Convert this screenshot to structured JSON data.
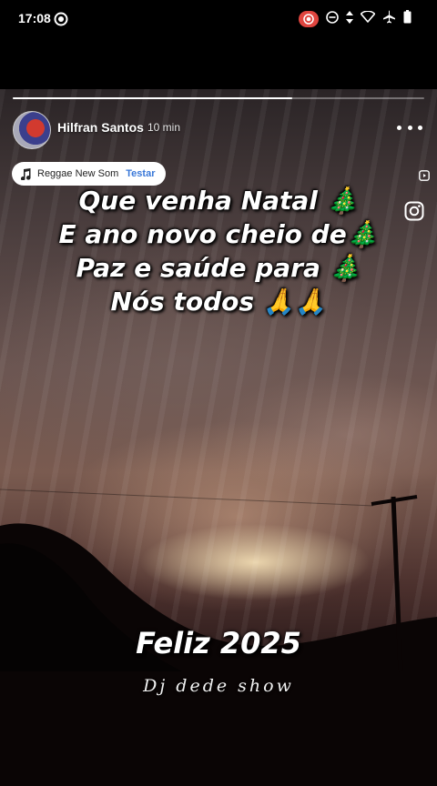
{
  "status_bar": {
    "time": "17:08",
    "icons": [
      "screen-record-icon",
      "do-not-disturb-icon",
      "data-arrows-icon",
      "wifi-icon",
      "airplane-mode-icon",
      "battery-icon"
    ],
    "record_color": "#e0453f"
  },
  "story": {
    "progress": 0.68,
    "username": "Hilfran Santos",
    "time_ago": "10 min",
    "music": {
      "title": "Reggae New Som",
      "action": "Testar"
    },
    "caption_lines": [
      "Que venha Natal 🎄",
      "E ano novo cheio de🎄",
      "Paz e saúde para 🎄",
      "Nós todos 🙏🙏"
    ],
    "greeting": "Feliz 2025",
    "signature": "Dj dede show"
  },
  "colors": {
    "accent_link": "#3a78d8",
    "background": "#000000"
  }
}
